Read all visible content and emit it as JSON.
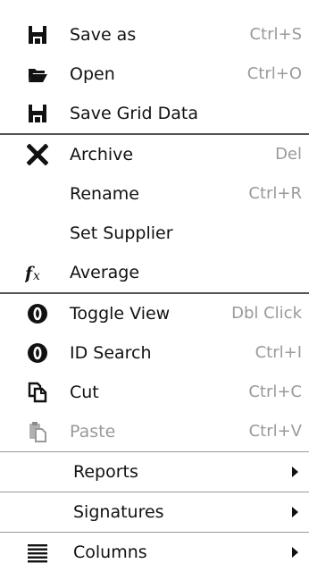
{
  "menu": {
    "items": [
      {
        "label": "Save as",
        "shortcut": "Ctrl+S",
        "icon": "save-icon"
      },
      {
        "label": "Open",
        "shortcut": "Ctrl+O",
        "icon": "folder-open-icon"
      },
      {
        "label": "Save Grid Data",
        "shortcut": "",
        "icon": "save-icon"
      },
      {
        "label": "Archive",
        "shortcut": "Del",
        "icon": "delete-x-icon"
      },
      {
        "label": "Rename",
        "shortcut": "Ctrl+R",
        "icon": ""
      },
      {
        "label": "Set Supplier",
        "shortcut": "",
        "icon": ""
      },
      {
        "label": "Average",
        "shortcut": "",
        "icon": "function-fx-icon"
      },
      {
        "label": "Toggle View",
        "shortcut": "Dbl Click",
        "icon": "circle-zero-icon"
      },
      {
        "label": "ID Search",
        "shortcut": "Ctrl+I",
        "icon": "circle-zero-icon"
      },
      {
        "label": "Cut",
        "shortcut": "Ctrl+C",
        "icon": "cut-pages-icon"
      },
      {
        "label": "Paste",
        "shortcut": "Ctrl+V",
        "icon": "paste-icon",
        "disabled": true
      }
    ],
    "submenus": [
      {
        "label": "Reports",
        "icon": ""
      },
      {
        "label": "Signatures",
        "icon": ""
      },
      {
        "label": "Columns",
        "icon": "columns-lines-icon"
      }
    ]
  },
  "colors": {
    "text": "#111111",
    "shortcut": "#9a9a9a",
    "separator": "#555555"
  }
}
